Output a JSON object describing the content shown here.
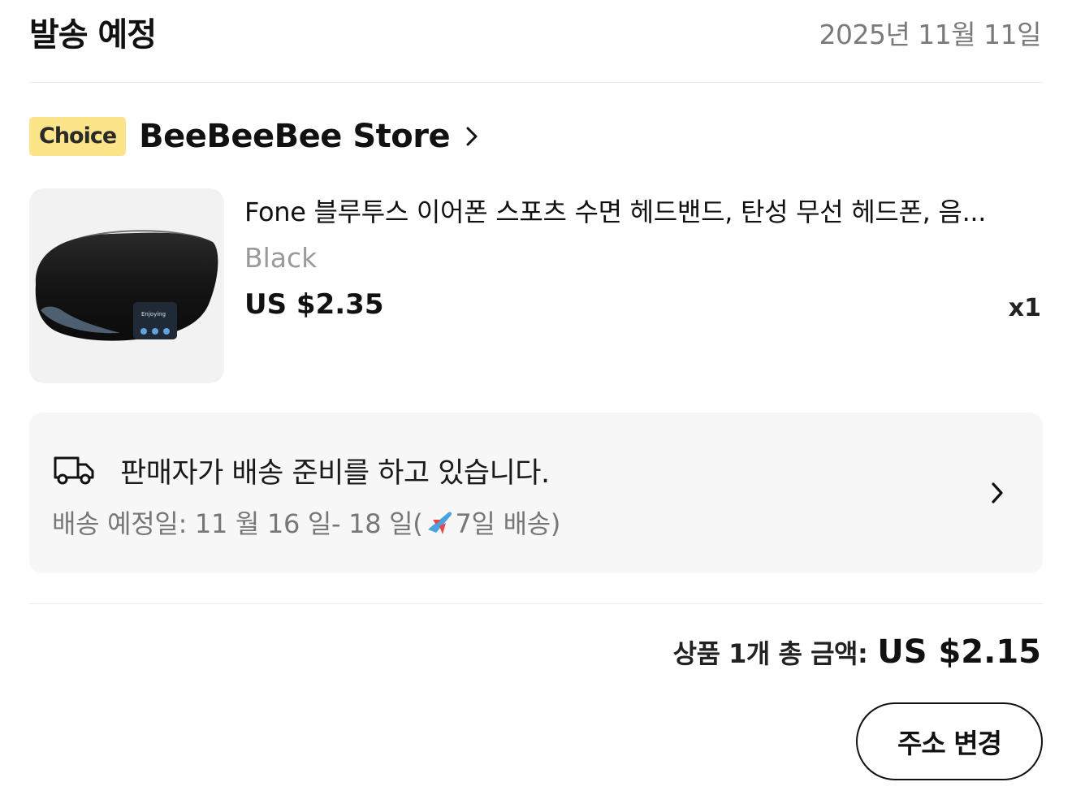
{
  "header": {
    "title": "발송 예정",
    "date": "2025년 11월 11일"
  },
  "store": {
    "badge": "Choice",
    "name": "BeeBeeBee Store",
    "chevron_icon": "chevron-right-icon"
  },
  "product": {
    "title": "Fone 블루투스 이어폰 스포츠 수면 헤드밴드, 탄성 무선 헤드폰, 음...",
    "variant": "Black",
    "price": "US $2.35",
    "quantity": "x1",
    "image_text": "Enjoying"
  },
  "shipping": {
    "status": "판매자가 배송 준비를 하고 있습니다.",
    "estimate_prefix": "배송 예정일: 11 월 16 일- 18 일(",
    "estimate_suffix": "7일 배송)",
    "icon": "truck-icon"
  },
  "summary": {
    "label": "상품 1개 총 금액:",
    "total": "US $2.15"
  },
  "actions": {
    "change_address": "주소 변경"
  }
}
